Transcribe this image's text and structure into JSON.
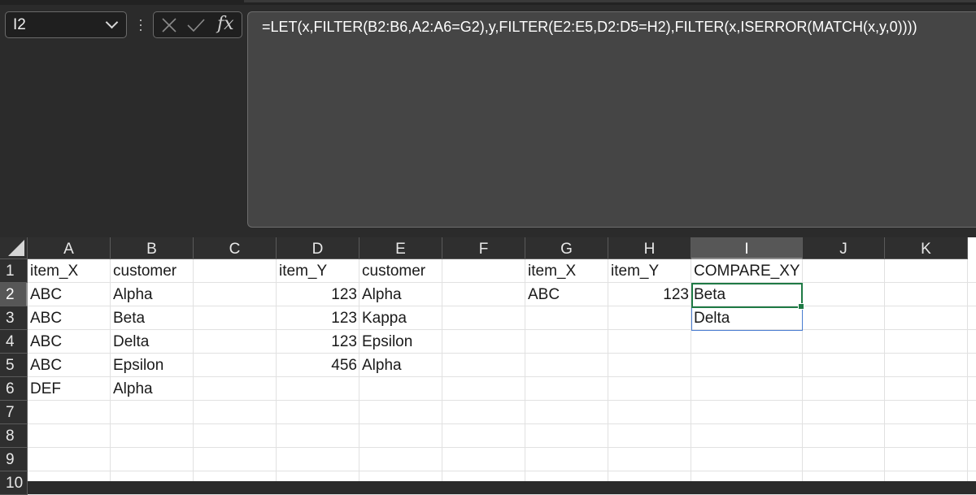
{
  "name_box": {
    "value": "I2"
  },
  "formula_bar": {
    "formula": "=LET(x,FILTER(B2:B6,A2:A6=G2),y,FILTER(E2:E5,D2:D5=H2),FILTER(x,ISERROR(MATCH(x,y,0))))",
    "fx_label": "fx"
  },
  "columns": [
    "A",
    "B",
    "C",
    "D",
    "E",
    "F",
    "G",
    "H",
    "I",
    "J",
    "K"
  ],
  "active_column": "I",
  "rows": [
    "1",
    "2",
    "3",
    "4",
    "5",
    "6",
    "7",
    "8",
    "9",
    "10"
  ],
  "active_row": "2",
  "cells": {
    "A1": "item_X",
    "B1": "customer",
    "D1": "item_Y",
    "E1": "customer",
    "G1": "item_X",
    "H1": "item_Y",
    "I1": "COMPARE_XY",
    "A2": "ABC",
    "B2": "Alpha",
    "D2": "123",
    "E2": "Alpha",
    "G2": "ABC",
    "H2": "123",
    "I2": "Beta",
    "A3": "ABC",
    "B3": "Beta",
    "D3": "123",
    "E3": "Kappa",
    "I3": "Delta",
    "A4": "ABC",
    "B4": "Delta",
    "D4": "123",
    "E4": "Epsilon",
    "A5": "ABC",
    "B5": "Epsilon",
    "D5": "456",
    "E5": "Alpha",
    "A6": "DEF",
    "B6": "Alpha"
  },
  "colors": {
    "selection_border": "#1f7a45",
    "spill_border": "#4a7dd1",
    "header_bg": "#2f2f2f",
    "active_header_bg": "#575757"
  }
}
